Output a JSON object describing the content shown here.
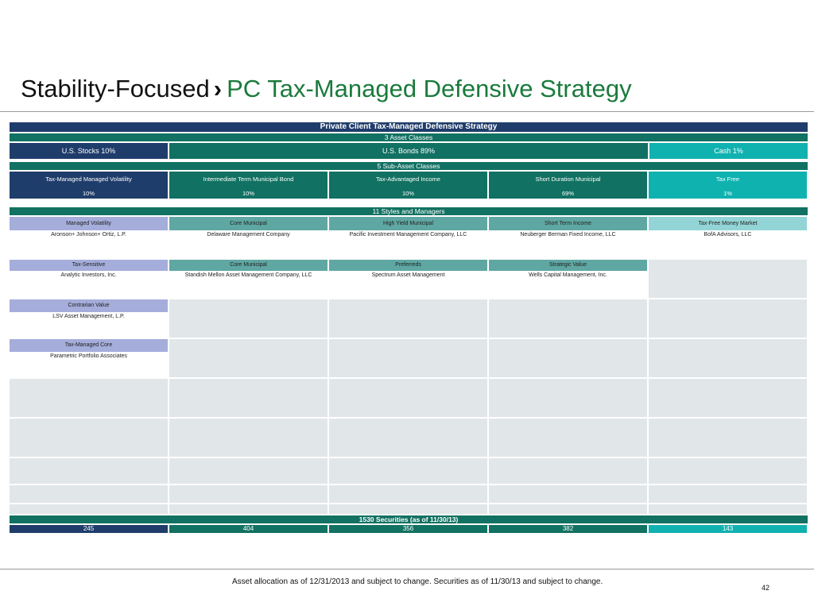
{
  "title": {
    "prefix": "Stability-Focused",
    "arrow": "›",
    "main": "PC Tax-Managed Defensive Strategy"
  },
  "table": {
    "header": "Private Client Tax-Managed Defensive Strategy",
    "asset_classes_header": "3 Asset Classes",
    "asset_classes": [
      {
        "label": "U.S. Stocks 10%",
        "color": "#1f3d6b"
      },
      {
        "label": "U.S. Bonds 89%",
        "color": "#117162"
      },
      {
        "label": "Cash 1%",
        "color": "#10b2b0"
      }
    ],
    "sub_asset_header": "5 Sub-Asset Classes",
    "sub_assets": [
      {
        "name": "Tax-Managed Managed Volatility",
        "pct": "10%"
      },
      {
        "name": "Intermediate Term Municipal Bond",
        "pct": "10%"
      },
      {
        "name": "Tax-Advantaged Income",
        "pct": "10%"
      },
      {
        "name": "Short Duration Municipal",
        "pct": "69%"
      },
      {
        "name": "Tax Free",
        "pct": "1%"
      }
    ],
    "styles_header": "11 Styles and Managers",
    "styles_row1": [
      {
        "style": "Managed Volatility",
        "manager": "Aronson+ Johnson+ Ortiz, L.P."
      },
      {
        "style": "Core Municipal",
        "manager": "Delaware Management Company"
      },
      {
        "style": "High Yield Municipal",
        "manager": "Pacific Investment Management Company, LLC"
      },
      {
        "style": "Short Term Income",
        "manager": "Neuberger Berman Fixed Income, LLC"
      },
      {
        "style": "Tax-Free Money Market",
        "manager": "BofA Advisors, LLC"
      }
    ],
    "styles_row2": [
      {
        "style": "Tax-Sensitive",
        "manager": "Analytic Investors, Inc."
      },
      {
        "style": "Core Municipal",
        "manager": "Standish Mellon Asset Management Company, LLC"
      },
      {
        "style": "Preferreds",
        "manager": "Spectrum Asset Management"
      },
      {
        "style": "Strategic Value",
        "manager": "Wells Capital Management, Inc."
      }
    ],
    "styles_row3": {
      "style": "Contrarian Value",
      "manager": "LSV Asset Management, L.P."
    },
    "styles_row4": {
      "style": "Tax-Managed Core",
      "manager": "Parametric Portfolio Associates"
    },
    "securities_header": "1530 Securities (as of 11/30/13)",
    "securities": [
      "245",
      "404",
      "356",
      "382",
      "143"
    ]
  },
  "footnote": "Asset  allocation as of 12/31/2013 and subject to change.  Securities as of 11/30/13 and subject to change.",
  "page_number": "42",
  "colors": {
    "navy": "#1f3d6b",
    "teal": "#117162",
    "cyan": "#10b2b0",
    "lavender": "#a5addb",
    "sea": "#5fa7a2",
    "aqua": "#93d4d6",
    "title_green": "#1a7a3c",
    "filler_grey": "#e1e6e8"
  }
}
